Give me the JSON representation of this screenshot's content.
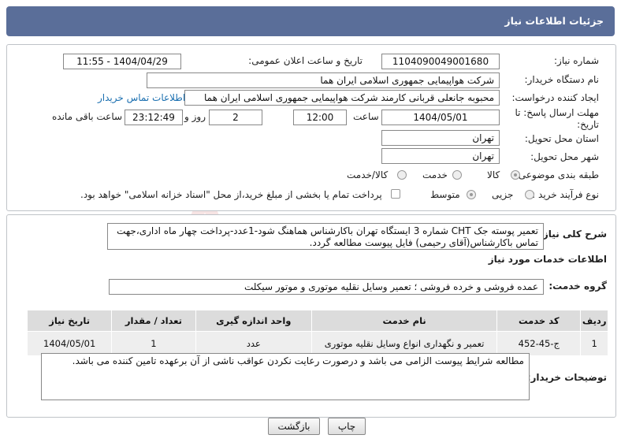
{
  "header": {
    "title": "جزئیات اطلاعات نیاز"
  },
  "form": {
    "need_number_label": "شماره نیاز:",
    "need_number": "1104090049001680",
    "announce_label": "تاریخ و ساعت اعلان عمومی:",
    "announce_value": "1404/04/29 - 11:55",
    "buyer_org_label": "نام دستگاه خریدار:",
    "buyer_org": "شرکت هواپیمایی جمهوری اسلامی ایران هما",
    "creator_label": "ایجاد کننده درخواست:",
    "creator": "محبوبه جانعلی قربانی کارمند شرکت هواپیمایی جمهوری اسلامی ایران هما",
    "buyer_contact_link": "اطلاعات تماس خریدار",
    "deadline_label": "مهلت ارسال پاسخ: تا تاریخ:",
    "deadline_date": "1404/05/01",
    "time_label": "ساعت",
    "deadline_time": "12:00",
    "days_value": "2",
    "days_label": "روز و",
    "remaining_time": "23:12:49",
    "remaining_label": "ساعت باقی مانده",
    "province_label": "استان محل تحویل:",
    "province": "تهران",
    "city_label": "شهر محل تحویل:",
    "city": "تهران",
    "category_label": "طبقه بندی موضوعی:",
    "category_options": [
      "کالا",
      "خدمت",
      "کالا/خدمت"
    ],
    "process_label": "نوع فرآیند خرید :",
    "process_options": [
      "جزیی",
      "متوسط"
    ],
    "payment_note": "پرداخت تمام یا بخشی از مبلغ خرید،از محل \"اسناد خزانه اسلامی\" خواهد بود."
  },
  "summary": {
    "label": "شرح کلی نیاز:",
    "text": "تعمیر پوسته جک CHT  شماره 3 ایستگاه تهران باکارشناس هماهنگ شود-1عدد-پرداخت چهار ماه اداری،جهت تماس باکارشناس(آقای رحیمی) فایل پیوست مطالعه گردد."
  },
  "services": {
    "section_title": "اطلاعات خدمات مورد نیاز",
    "group_label": "گروه خدمت:",
    "group_value": "عمده فروشی و خرده فروشی ؛ تعمیر وسایل نقلیه موتوری و موتور سیکلت",
    "columns": [
      "ردیف",
      "کد خدمت",
      "نام خدمت",
      "واحد اندازه گیری",
      "تعداد / مقدار",
      "تاریخ نیاز"
    ],
    "rows": [
      {
        "index": "1",
        "code": "ج-45-452",
        "name": "تعمیر و نگهداری انواع وسایل نقلیه موتوری",
        "unit": "عدد",
        "qty": "1",
        "date": "1404/05/01"
      }
    ]
  },
  "buyer_notes": {
    "label": "توضیحات خریدار:",
    "text": "مطالعه شرایط پیوست الزامی می باشد و درصورت رعایت نکردن عواقب ناشی از آن برعهده تامین کننده می باشد."
  },
  "buttons": {
    "print": "چاپ",
    "back": "بازگشت"
  },
  "colors": {
    "header_bg": "#5a6e99",
    "link": "#1a6fb0"
  }
}
